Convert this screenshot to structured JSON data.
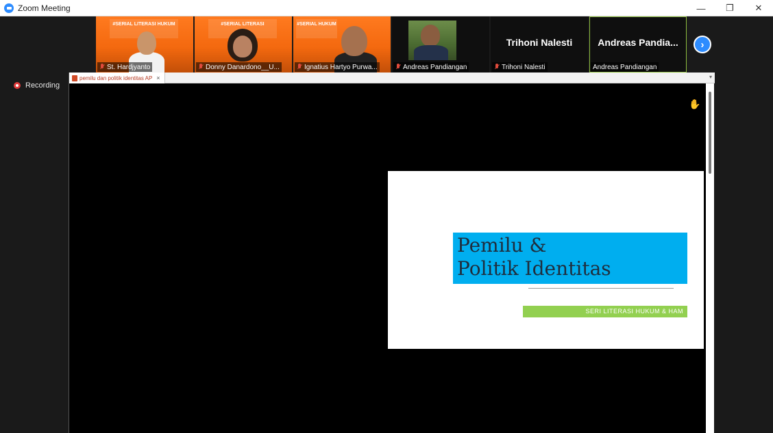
{
  "window": {
    "title": "Zoom Meeting",
    "controls": {
      "minimize": "—",
      "restore": "❐",
      "close": "✕"
    }
  },
  "participants": [
    {
      "name": "St. Hardjyanto",
      "muted": true,
      "banner": "#SERIAL LITERASI HUKUM"
    },
    {
      "name": "Donny Danardono__U...",
      "muted": true,
      "banner": "#SERIAL LITERASI"
    },
    {
      "name": "Ignatius Hartyo Purwa...",
      "muted": true,
      "banner": "#SERIAL HUKUM"
    },
    {
      "name": "Andreas Pandiangan",
      "muted": true
    },
    {
      "name": "Trihoni Nalesti",
      "display_name": "Trihoni Nalesti",
      "muted": true
    },
    {
      "name": "Andreas Pandiangan",
      "display_name": "Andreas  Pandia...",
      "muted": false,
      "active_speaker": true
    }
  ],
  "gallery_next": "›",
  "recording": {
    "label": "Recording"
  },
  "share": {
    "tab_label": "pemilu dan politik identitas AP",
    "tab_close": "×",
    "dropdown": "▾"
  },
  "slide": {
    "title": "Pemilu &\nPolitik Identitas",
    "subtitle": "SERI LITERASI HUKUM & HAM"
  },
  "colors": {
    "accent": "#2d8cff",
    "slide_title_bg": "#00aeef",
    "slide_subtitle_bg": "#92d050",
    "recording": "#e23b3b"
  }
}
